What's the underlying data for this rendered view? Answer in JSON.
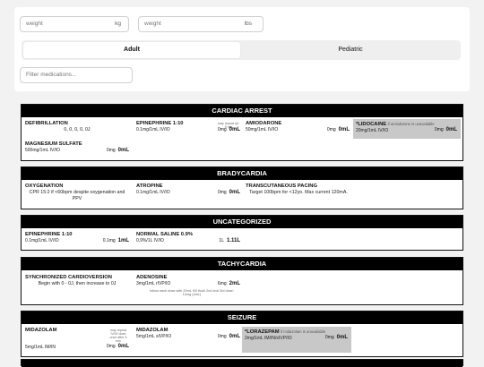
{
  "inputs": {
    "weight_kg_placeholder": "weight",
    "weight_kg_unit": "kg",
    "weight_lbs_placeholder": "weight",
    "weight_lbs_unit": "lbs",
    "filter_placeholder": "Filter medications..."
  },
  "tabs": [
    {
      "label": "Adult",
      "active": true
    },
    {
      "label": "Pediatric",
      "active": false
    }
  ],
  "sections": {
    "cardiac_arrest": {
      "title": "CARDIAC ARREST",
      "defib": {
        "name": "DEFIBRILLATION",
        "desc": "0, 0, 0, 0, 0J"
      },
      "epi": {
        "name": "EPINEPHRINE 1:10",
        "note": "may repeat q3-5 min",
        "conc": "0.1mg/1mL IV/IO",
        "dose_mg": "0mg",
        "dose_ml": "0mL"
      },
      "amio": {
        "name": "AMIODARONE",
        "conc": "50mg/1mL IV/IO",
        "dose_mg": "0mg",
        "dose_ml": "0mL"
      },
      "lido": {
        "name": "*LIDOCAINE",
        "note": "if amiodarone is unavailable",
        "conc": "20mg/1mL IV/IO",
        "dose_mg": "0mg",
        "dose_ml": "0mL"
      },
      "mag": {
        "name": "MAGNESIUM SULFATE",
        "conc": "500mg/1mL IV/IO",
        "dose_mg": "0mg",
        "dose_ml": "0mL"
      }
    },
    "bradycardia": {
      "title": "BRADYCARDIA",
      "oxy": {
        "name": "OXYGENATION",
        "desc": "CPR 15:2 if <60bpm despite oxygenation and PPV"
      },
      "atropine": {
        "name": "ATROPINE",
        "conc": "0.1mg/1mL IV/IO",
        "dose_mg": "0mg",
        "dose_ml": "0mL"
      },
      "pacing": {
        "name": "TRANSCUTANEOUS PACING",
        "desc": "Target 100bpm for <12yo. Max current 120mA."
      }
    },
    "uncategorized": {
      "title": "UNCATEGORIZED",
      "epi": {
        "name": "EPINEPHRINE 1:10",
        "conc": "0.1mg/1mL IV/IO",
        "dose_mg": "0.1mg",
        "dose_ml": "1mL"
      },
      "saline": {
        "name": "NORMAL SALINE 0.9%",
        "conc": "0.9%/1L IV/IO",
        "dose_mg": "1L",
        "dose_ml": "1.11L"
      }
    },
    "tachycardia": {
      "title": "TACHYCARDIA",
      "cardioversion": {
        "name": "SYNCHRONIZED CARDIOVERSION",
        "desc": "Begin with 0 - 0J, then increase to 0J"
      },
      "adenosine": {
        "name": "ADENOSINE",
        "conc": "3mg/1mL rIVP/IO",
        "dose_mg": "6mg",
        "dose_ml": "2mL",
        "note": "follow each dose with 20mL NS flush 2nd and 3rd dose: 12mg (4mL)"
      }
    },
    "seizure": {
      "title": "SEIZURE",
      "midaz1": {
        "name": "MIDAZOLAM",
        "note": "may repeat IV/IO dose once after 5 min",
        "conc": "5mg/1mL IM/IN",
        "dose_mg": "0mg",
        "dose_ml": "0mL"
      },
      "midaz2": {
        "name": "MIDAZOLAM",
        "conc": "5mg/1mL sIVP/IO",
        "dose_mg": "0mg",
        "dose_ml": "0mL"
      },
      "loraz": {
        "name": "*LORAZEPAM",
        "note": "if midazolam is unavailable",
        "conc": "2mg/1mL IM/IN/sIVP/IO",
        "dose_mg": "0mg",
        "dose_ml": "0mL"
      }
    }
  }
}
